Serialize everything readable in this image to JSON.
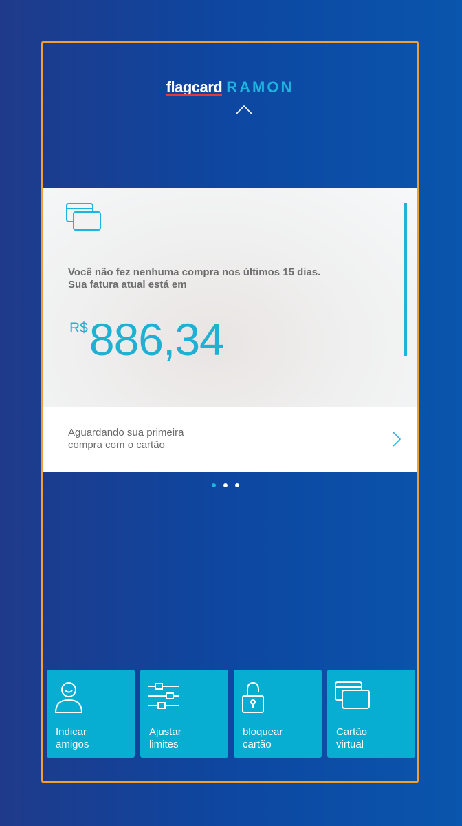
{
  "header": {
    "brand": "flagcard",
    "user_name": "RAMON"
  },
  "card": {
    "message_line1": "Você não fez nenhuma compra nos últimos 15 dias.",
    "message_line2": "Sua fatura atual está em",
    "currency": "R$",
    "amount": "886,34",
    "footer_line1": "Aguardando sua primeira",
    "footer_line2": "compra com o cartão"
  },
  "carousel": {
    "pages": 3,
    "active_index": 0
  },
  "actions": [
    {
      "line1": "Indicar",
      "line2": "amigos",
      "icon": "refer-friend-icon"
    },
    {
      "line1": "Ajustar",
      "line2": "limites",
      "icon": "sliders-icon"
    },
    {
      "line1": "bloquear",
      "line2": "cartão",
      "icon": "padlock-icon"
    },
    {
      "line1": "Cartão",
      "line2": "virtual",
      "icon": "virtual-card-icon"
    }
  ],
  "colors": {
    "accent": "#1db4e0",
    "tile": "#08aed2",
    "frame": "#f0a030",
    "background": "#0d47a1"
  }
}
